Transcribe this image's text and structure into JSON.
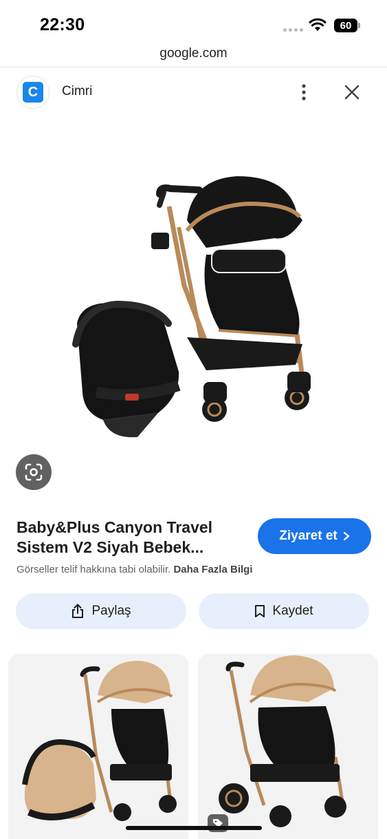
{
  "status_bar": {
    "time": "22:30",
    "battery": "60"
  },
  "browser": {
    "url": "google.com"
  },
  "source": {
    "favicon_letter": "C",
    "name": "Cimri",
    "favicon_color": "#1a86e8"
  },
  "icons": {
    "more": "more-vertical-icon",
    "close": "close-icon",
    "lens": "google-lens-icon",
    "share": "share-icon",
    "save": "bookmark-icon",
    "visit_chevron": "chevron-right-icon",
    "tag": "tag-icon"
  },
  "product": {
    "title_line1": "Baby&Plus Canyon Travel",
    "title_line2": "Sistem V2 Siyah Bebek..."
  },
  "visit_button": {
    "label": "Ziyaret et",
    "color": "#1a73e8"
  },
  "copyright": {
    "notice": "Görseller telif hakkına tabi olabilir.",
    "more_info": "Daha Fazla Bilgi"
  },
  "actions": {
    "share_label": "Paylaş",
    "save_label": "Kaydet"
  },
  "colors": {
    "action_bg": "#e8effc",
    "stroller_black": "#141414",
    "frame_gold": "#b98a5a",
    "canopy_beige": "#d8b48c"
  }
}
